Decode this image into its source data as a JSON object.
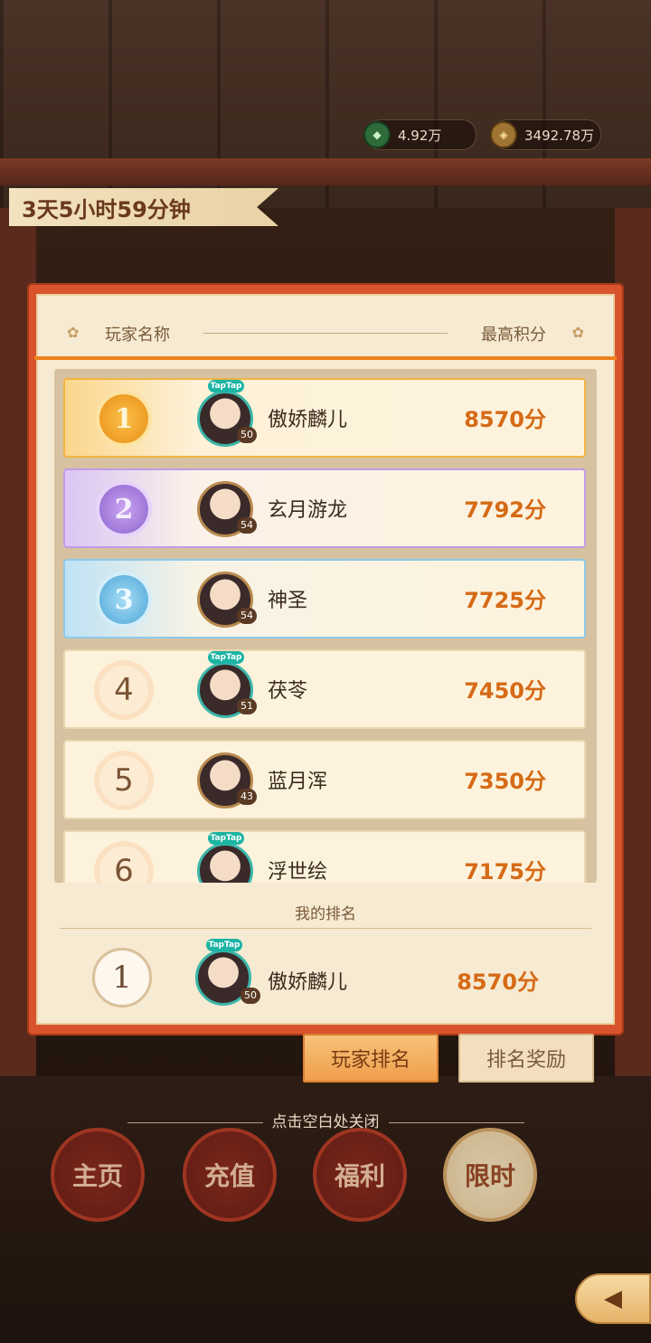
{
  "currency": [
    {
      "icon": "jade-coin-icon",
      "value": "4.92万"
    },
    {
      "icon": "copper-coin-icon",
      "value": "3492.78万"
    }
  ],
  "timer": "3天5小时59分钟",
  "table_header": {
    "name": "玩家名称",
    "score": "最高积分"
  },
  "rankings": [
    {
      "rank": "1",
      "name": "傲娇麟儿",
      "score": "8570分",
      "level": "50",
      "taptap": true
    },
    {
      "rank": "2",
      "name": "玄月游龙",
      "score": "7792分",
      "level": "54",
      "taptap": false
    },
    {
      "rank": "3",
      "name": "神圣",
      "score": "7725分",
      "level": "54",
      "taptap": false
    },
    {
      "rank": "4",
      "name": "茯苓",
      "score": "7450分",
      "level": "51",
      "taptap": true
    },
    {
      "rank": "5",
      "name": "蓝月浑",
      "score": "7350分",
      "level": "43",
      "taptap": false
    },
    {
      "rank": "6",
      "name": "浮世绘",
      "score": "7175分",
      "level": "",
      "taptap": true
    }
  ],
  "my_rank": {
    "title": "我的排名",
    "rank": "1",
    "name": "傲娇麟儿",
    "score": "8570分",
    "level": "50"
  },
  "taptap_label": "TapTap",
  "tabs": {
    "player_rank": "玩家排名",
    "rank_reward": "排名奖励"
  },
  "close_hint": "点击空白处关闭",
  "nav": {
    "home": "主页",
    "charge": "充值",
    "benefit": "福利",
    "limited": "限时"
  },
  "colors": {
    "accent": "#f0821e",
    "score": "#d66a16",
    "panel": "#d9542c"
  }
}
